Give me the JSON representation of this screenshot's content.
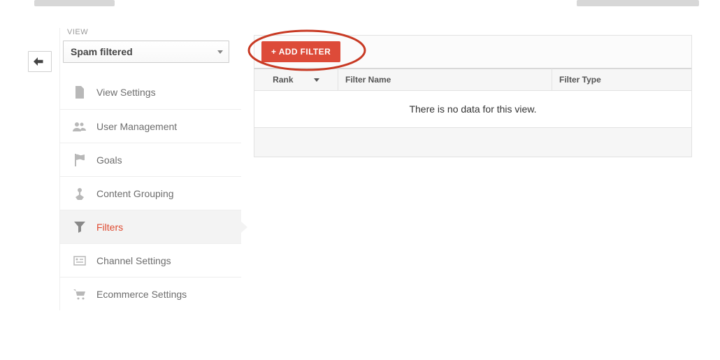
{
  "sidebar": {
    "section_label": "VIEW",
    "selected_view": "Spam filtered",
    "items": [
      {
        "label": "View Settings"
      },
      {
        "label": "User Management"
      },
      {
        "label": "Goals"
      },
      {
        "label": "Content Grouping"
      },
      {
        "label": "Filters",
        "active": true
      },
      {
        "label": "Channel Settings"
      },
      {
        "label": "Ecommerce Settings"
      }
    ]
  },
  "main": {
    "add_button_label": "+ ADD FILTER",
    "columns": {
      "rank": "Rank",
      "filter_name": "Filter Name",
      "filter_type": "Filter Type"
    },
    "empty_message": "There is no data for this view."
  },
  "colors": {
    "accent_red": "#dd4b39"
  }
}
